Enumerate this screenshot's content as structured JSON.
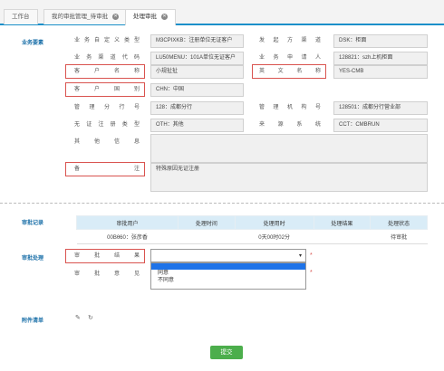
{
  "tabs": [
    {
      "label": "工作台"
    },
    {
      "label": "我的审批管理_待审批"
    },
    {
      "label": "处理审批"
    }
  ],
  "business": {
    "title": "业务要素",
    "fields": [
      {
        "label": "业务自定义类型",
        "value": "M3CPIXKB：注册单位无证客户"
      },
      {
        "label": "发起方渠道",
        "value": "DSK：柜面"
      },
      {
        "label": "业务渠道代码",
        "value": "LU50MENU：101A单位无证客户"
      },
      {
        "label": "业务申请人",
        "value": "128821：szh上机柜面"
      },
      {
        "label": "客户名称",
        "value": "小规扯扯"
      },
      {
        "label": "英文名称",
        "value": "YES-CMB"
      },
      {
        "label": "客户国别",
        "value": "CHN：中国"
      },
      {
        "label": "管理分行号",
        "value": "128：成都分行"
      },
      {
        "label": "管理机构号",
        "value": "128501：成都分行营业部"
      },
      {
        "label": "无证注册类型",
        "value": "OTH：其他"
      },
      {
        "label": "来源系统",
        "value": "CCT：CMBRUN"
      },
      {
        "label": "其他信息",
        "value": ""
      },
      {
        "label": "备注",
        "value": "特殊原因无证注册"
      }
    ]
  },
  "records": {
    "title": "审批记录",
    "headers": [
      "审批用户",
      "处理时间",
      "处理用时",
      "处理结果",
      "处理状态"
    ],
    "rows": [
      {
        "user": "00Bθ60：张彦香",
        "time": "",
        "duration": "0天00时02分",
        "result": "",
        "status": "待审批"
      }
    ]
  },
  "process": {
    "title": "审批处理",
    "result_label": "审批结果",
    "opinion_label": "审批意见",
    "selected": "",
    "options": [
      "",
      "同意",
      "不同意"
    ],
    "required_mark": "*"
  },
  "attachments": {
    "title": "附件清单"
  },
  "submit_label": "提交",
  "colors": {
    "accent": "#1a8fc9",
    "highlight": "#d9534f",
    "submit": "#4cae4c",
    "table_header": "#d9ecf7"
  }
}
